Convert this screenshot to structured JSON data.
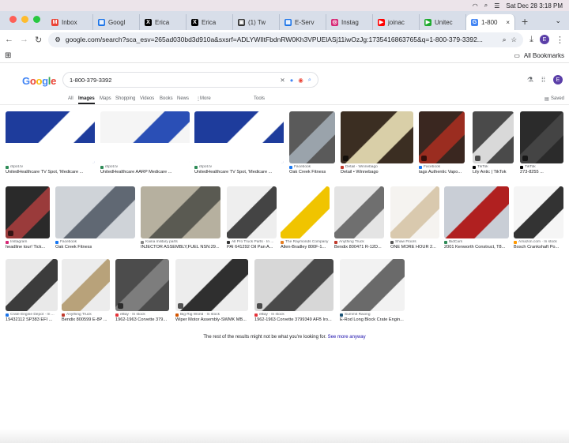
{
  "menubar": {
    "datetime": "Sat Dec 28  3:18 PM",
    "icons": [
      "wifi-icon",
      "search-icon",
      "control-center-icon"
    ]
  },
  "tabs": [
    {
      "label": "Inbox",
      "color": "#ea4335",
      "glyph": "M"
    },
    {
      "label": "Googl",
      "color": "#1a73e8",
      "glyph": "▦"
    },
    {
      "label": "Erica",
      "color": "#000000",
      "glyph": "X"
    },
    {
      "label": "Erica",
      "color": "#000000",
      "glyph": "X"
    },
    {
      "label": "(1) Tw",
      "color": "#333333",
      "glyph": "▣"
    },
    {
      "label": "E-Serv",
      "color": "#1a73e8",
      "glyph": "▦"
    },
    {
      "label": "Instag",
      "color": "#d62976",
      "glyph": "◎"
    },
    {
      "label": "joinac",
      "color": "#ff0000",
      "glyph": "▶"
    },
    {
      "label": "Unitec",
      "color": "#1fab2f",
      "glyph": "▶"
    },
    {
      "label": "1-800",
      "color": "#4285f4",
      "glyph": "G",
      "active": true
    }
  ],
  "address": {
    "url": "google.com/search?sca_esv=265ad030bd3d910a&sxsrf=ADLYWIltFbdnRW0Kh3VPUElASj11iwOzJg:1735416863765&q=1-800-379-3392..."
  },
  "profile_initial": "E",
  "bookmarks": {
    "all_label": "All Bookmarks"
  },
  "google": {
    "logo": "Google",
    "query": "1-800-379-3392",
    "saved": "Saved"
  },
  "search_tabs": {
    "all": "All",
    "images": "Images",
    "maps": "Maps",
    "shopping": "Shopping",
    "videos": "Videos",
    "books": "Books",
    "news": "News",
    "more": "More",
    "tools": "Tools"
  },
  "results": [
    {
      "source": "iSpot.tv",
      "title": "UnitedHealthcare TV Spot, 'Medicare ...",
      "dot": "#2e8b57"
    },
    {
      "source": "iSpot.tv",
      "title": "UnitedHealthcare AARP Medicare ...",
      "dot": "#2e8b57"
    },
    {
      "source": "iSpot.tv",
      "title": "UnitedHealthcare TV Spot, 'Medicare ...",
      "dot": "#2e8b57"
    },
    {
      "source": "Facebook",
      "title": "Oak Creek Fitness",
      "dot": "#1877f2"
    },
    {
      "source": "Detail - Winnebago",
      "title": "Detail • Winnebago",
      "dot": "#c0392b"
    },
    {
      "source": "Facebook",
      "title": "tags Authentic Vapo...",
      "dot": "#1877f2"
    },
    {
      "source": "TikTok",
      "title": "Lily Antic | TikTok",
      "dot": "#000000"
    },
    {
      "source": "TikTok",
      "title": "273-8255 ...",
      "dot": "#000000"
    },
    {
      "source": "Instagram",
      "title": "headline tour! Tick...",
      "dot": "#d62976"
    },
    {
      "source": "Facebook",
      "title": "Oak Creek Fitness",
      "dot": "#1877f2"
    },
    {
      "source": "Kaina military parts",
      "title": "INJECTOR ASSEMBLY,FUEL NSN:29...",
      "dot": "#888888"
    },
    {
      "source": "All Pro Truck Parts · In ...",
      "title": "PAI 641292 Oil Pan A...",
      "dot": "#333333"
    },
    {
      "source": "The Raymonds Company",
      "title": "Allen-Bradley 800F-1...",
      "dot": "#e67e22"
    },
    {
      "source": "Anything Truck",
      "title": "Bendix 800471 R-12D...",
      "dot": "#c0392b"
    },
    {
      "source": "Shaw Floors",
      "title": "ONE MORE HOUR 2...",
      "dot": "#555555"
    },
    {
      "source": "BidCars",
      "title": "2001 Kenworth Construct, T8...",
      "dot": "#2e8b57"
    },
    {
      "source": "Amazon.com · In stock",
      "title": "Bosch Crankshaft Po...",
      "dot": "#ff9900"
    },
    {
      "source": "Crate Engine Depot · In ...",
      "title": "19432112 SP383 EFI ...",
      "dot": "#1a73e8"
    },
    {
      "source": "Anything Truck",
      "title": "Bendix 800599 E-8P ...",
      "dot": "#c0392b"
    },
    {
      "source": "eBay · In stock",
      "title": "1962-1963 Corvette 379...",
      "dot": "#e53238"
    },
    {
      "source": "Big Rig World · In stock",
      "title": "Wiper Motor Assembly-SWMK MB...",
      "dot": "#d35400"
    },
    {
      "source": "eBay · In stock",
      "title": "1962-1963 Corvette 3799349 AFB Iro...",
      "dot": "#e53238"
    },
    {
      "source": "Summit Racing",
      "title": "E-Rod Long Block Crate Engin...",
      "dot": "#1a5276"
    }
  ],
  "footer": {
    "text": "The rest of the results might not be what you're looking for.",
    "link": "See more anyway"
  }
}
